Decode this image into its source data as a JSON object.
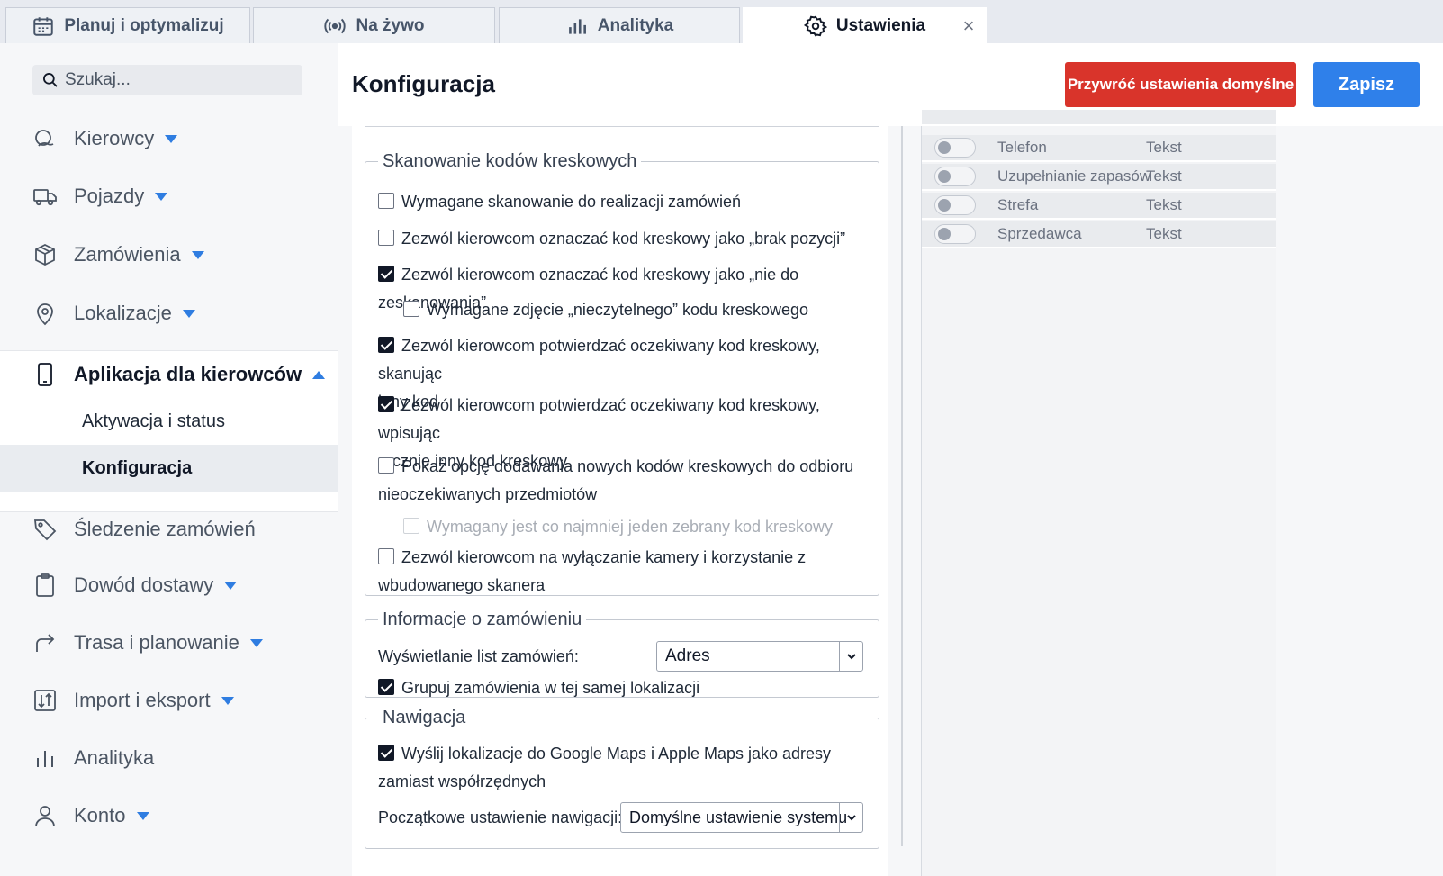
{
  "tabs": [
    {
      "label": "Planuj i optymalizuj",
      "icon": "calendar-icon"
    },
    {
      "label": "Na żywo",
      "icon": "broadcast-icon"
    },
    {
      "label": "Analityka",
      "icon": "bar-chart-icon"
    },
    {
      "label": "Ustawienia",
      "icon": "gear-icon",
      "active": true
    }
  ],
  "sidebar": {
    "search_placeholder": "Szukaj...",
    "items": [
      {
        "label": "Kierowcy",
        "icon": "drivers-icon"
      },
      {
        "label": "Pojazdy",
        "icon": "truck-icon"
      },
      {
        "label": "Zamówienia",
        "icon": "box-icon"
      },
      {
        "label": "Lokalizacje",
        "icon": "location-pin-icon"
      },
      {
        "label": "Aplikacja dla kierowców",
        "icon": "phone-icon"
      },
      {
        "label": "Śledzenie zamówień",
        "icon": "tag-icon"
      },
      {
        "label": "Dowód dostawy",
        "icon": "clipboard-icon"
      },
      {
        "label": "Trasa i planowanie",
        "icon": "route-arrow-icon"
      },
      {
        "label": "Import i eksport",
        "icon": "import-export-icon"
      },
      {
        "label": "Analityka",
        "icon": "bar-chart-icon"
      },
      {
        "label": "Konto",
        "icon": "user-icon"
      }
    ],
    "subitems": [
      "Aktywacja i status",
      "Konfiguracja"
    ]
  },
  "header": {
    "title": "Konfiguracja",
    "reset_label": "Przywróć ustawienia domyślne",
    "save_label": "Zapisz"
  },
  "barcode": {
    "legend": "Skanowanie kodów kreskowych",
    "options": [
      {
        "line1": "Wymagane skanowanie do realizacji zamówień",
        "line2": "",
        "checked": false
      },
      {
        "line1": "Zezwól kierowcom oznaczać kod kreskowy jako „brak pozycji”",
        "line2": "",
        "checked": false
      },
      {
        "line1": "Zezwól kierowcom oznaczać kod kreskowy jako „nie do zeskanowania”",
        "line2": "",
        "checked": true
      },
      {
        "line1": "Wymagane zdjęcie „nieczytelnego” kodu kreskowego",
        "line2": "",
        "checked": false
      },
      {
        "line1": "Zezwól kierowcom potwierdzać oczekiwany kod kreskowy, skanując",
        "line2": "inny kod",
        "checked": true
      },
      {
        "line1": "Zezwól kierowcom potwierdzać oczekiwany kod kreskowy, wpisując",
        "line2": "ręcznie inny kod kreskowy",
        "checked": true
      },
      {
        "line1": "Pokaż opcję dodawania nowych kodów kreskowych do odbioru",
        "line2": "nieoczekiwanych przedmiotów",
        "checked": false
      },
      {
        "line1": "Wymagany jest co najmniej jeden zebrany kod kreskowy",
        "line2": "",
        "checked": false,
        "disabled": true
      },
      {
        "line1": "Zezwól kierowcom na wyłączanie kamery i korzystanie z",
        "line2": "wbudowanego skanera",
        "checked": false
      }
    ]
  },
  "order_info": {
    "legend": "Informacje o zamówieniu",
    "display_label": "Wyświetlanie list zamówień:",
    "display_value": "Adres",
    "group_label": "Grupuj zamówienia w tej samej lokalizacji",
    "group_checked": true
  },
  "navigation": {
    "legend": "Nawigacja",
    "send_line1": "Wyślij lokalizacje do Google Maps i Apple Maps jako adresy",
    "send_line2": "zamiast współrzędnych",
    "send_checked": true,
    "initial_label": "Początkowe ustawienie nawigacji:",
    "initial_value": "Domyślne ustawienie systemu"
  },
  "fields": [
    {
      "name": "Telefon",
      "type": "Tekst"
    },
    {
      "name": "Uzupełnianie zapasów",
      "type": "Tekst"
    },
    {
      "name": "Strefa",
      "type": "Tekst"
    },
    {
      "name": "Sprzedawca",
      "type": "Tekst"
    }
  ],
  "colors": {
    "accent": "#2f80ea",
    "danger": "#d9342b",
    "caret": "#2f7de1"
  }
}
